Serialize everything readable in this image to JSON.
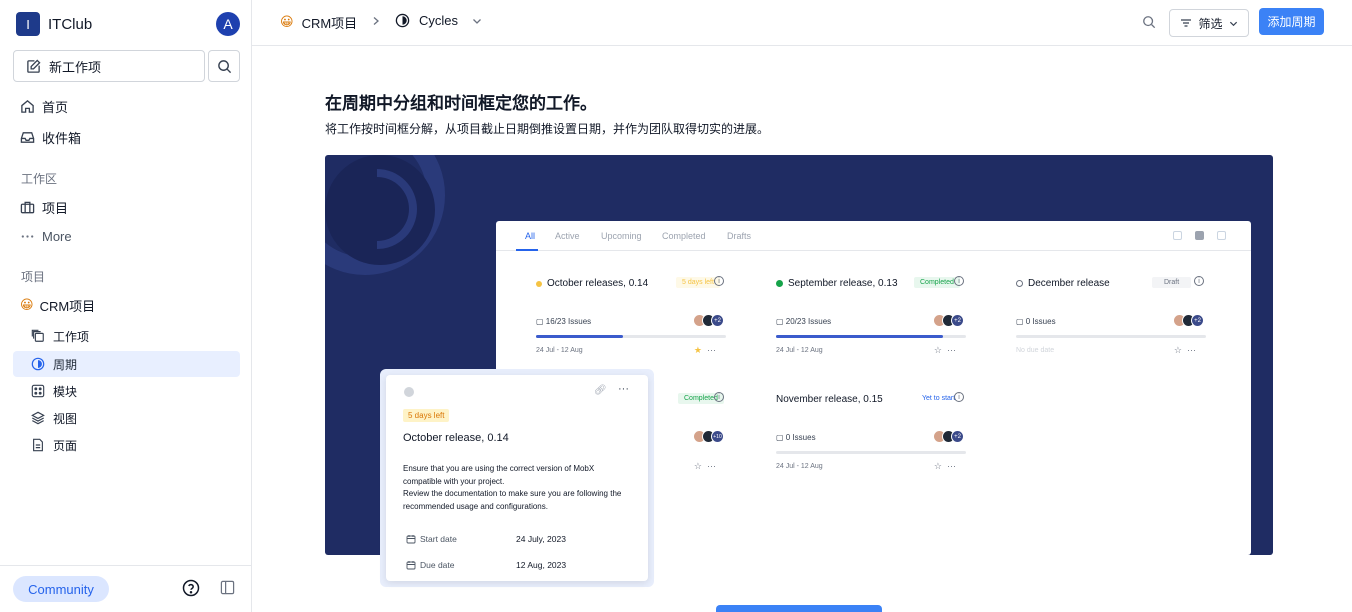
{
  "workspace": {
    "logo_letter": "I",
    "name": "ITClub",
    "avatar_letter": "A"
  },
  "sidebar": {
    "new_item_label": "新工作项",
    "nav": [
      {
        "label": "首页",
        "icon": "home-icon"
      },
      {
        "label": "收件箱",
        "icon": "inbox-icon"
      }
    ],
    "workspace_section": "工作区",
    "workspace_items": [
      {
        "label": "项目",
        "icon": "briefcase-icon"
      },
      {
        "label": "More",
        "icon": "more-icon"
      }
    ],
    "projects_section": "项目",
    "project": {
      "emoji": "😀",
      "name": "CRM项目"
    },
    "project_items": [
      {
        "label": "工作项",
        "icon": "layers-icon"
      },
      {
        "label": "周期",
        "icon": "cycle-icon",
        "active": true
      },
      {
        "label": "模块",
        "icon": "module-icon"
      },
      {
        "label": "视图",
        "icon": "stack-icon"
      },
      {
        "label": "页面",
        "icon": "page-icon"
      }
    ],
    "community_label": "Community"
  },
  "topbar": {
    "project_emoji": "😀",
    "project_name": "CRM项目",
    "current": "Cycles",
    "filter_label": "筛选",
    "add_label": "添加周期"
  },
  "main": {
    "title": "在周期中分组和时间框定您的工作。",
    "description": "将工作按时间框分解，从项目截止日期倒推设置日期，并作为团队取得切实的进展。"
  },
  "mock": {
    "tabs": [
      "All",
      "Active",
      "Upcoming",
      "Completed",
      "Drafts"
    ],
    "cards": [
      {
        "title": "October releases, 0.14",
        "badge": "5 days left",
        "issues": "16/23 Issues",
        "progress": 0.46,
        "dates": "24 Jul - 12 Aug",
        "status_color": "#f5c343"
      },
      {
        "title": "September release, 0.13",
        "badge": "Completed",
        "issues": "20/23 Issues",
        "progress": 0.88,
        "dates": "24 Jul - 12 Aug",
        "status_color": "#16a34a"
      },
      {
        "title": "December release",
        "badge": "Draft",
        "issues": "0 Issues",
        "progress": 0,
        "dates": "No due date",
        "status_color": "#9ca3af"
      },
      {
        "title": "",
        "badge": "Completed",
        "issues": "",
        "progress": 0,
        "dates": "",
        "status_color": "#16a34a"
      },
      {
        "title": "November release, 0.15",
        "badge": "Yet to start",
        "issues": "0 Issues",
        "progress": 0,
        "dates": "24 Jul - 12 Aug",
        "status_color": "#2563eb"
      }
    ],
    "avatar_extra": "+2",
    "avatar_extra_alt": "+10",
    "modal": {
      "badge": "5 days left",
      "title": "October release, 0.14",
      "description_1": "Ensure that you are using the correct version of MobX compatible with your project.",
      "description_2": "Review the documentation to make sure you are following the recommended usage and configurations.",
      "start_label": "Start date",
      "start_value": "24 July, 2023",
      "due_label": "Due date",
      "due_value": "12 Aug, 2023"
    }
  },
  "colors": {
    "accent": "#3b82f6",
    "hero_bg": "#1f2c63",
    "sidebar_active": "#e8efff"
  }
}
